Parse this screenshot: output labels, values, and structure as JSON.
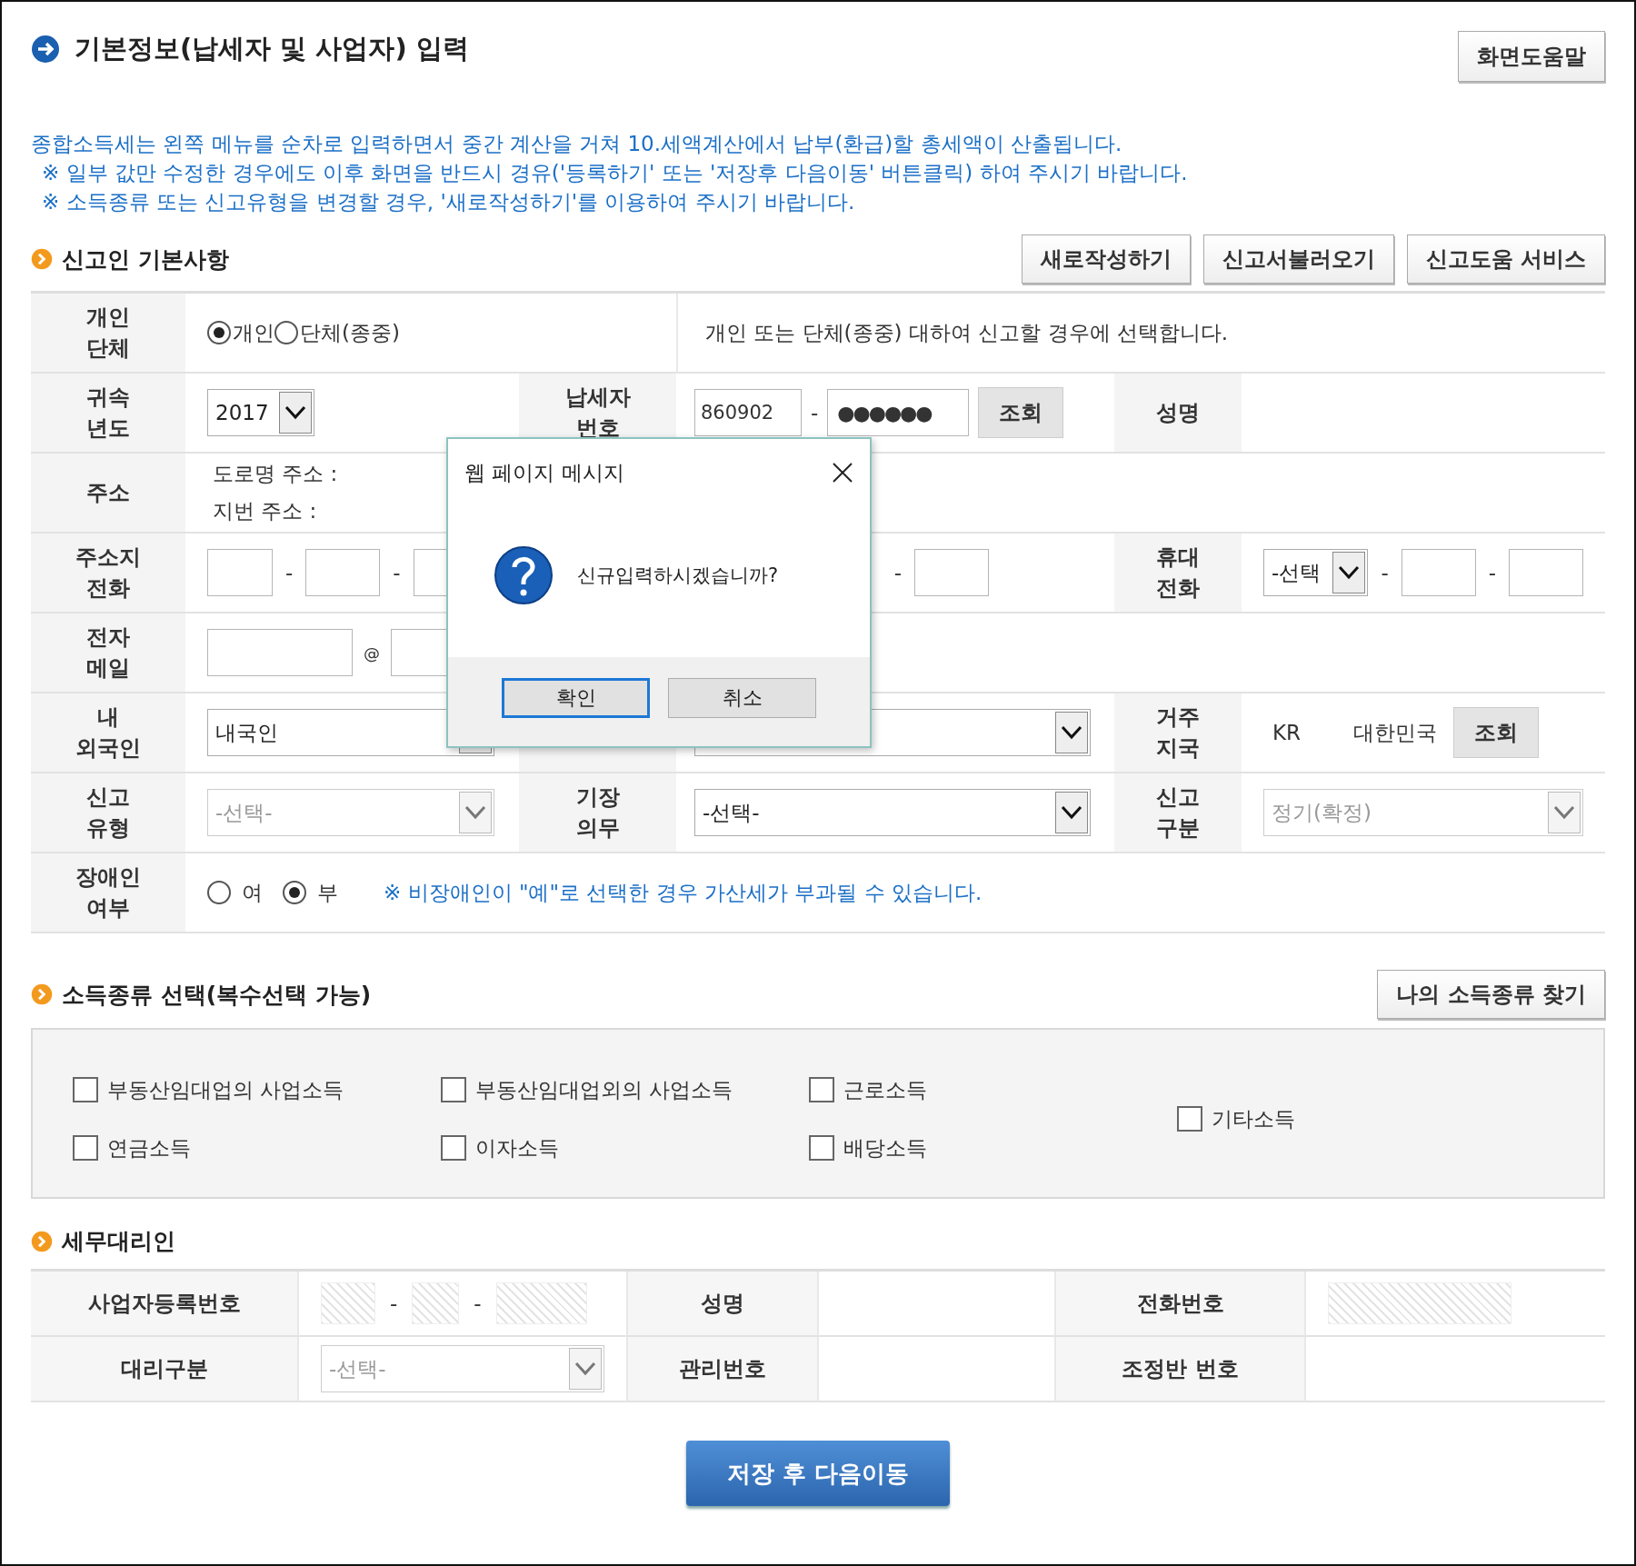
{
  "header": {
    "title": "기본정보(납세자 및 사업자) 입력",
    "help_button": "화면도움말"
  },
  "notices": [
    "종합소득세는 왼쪽 메뉴를 순차로 입력하면서 중간 계산을 거쳐 10.세액계산에서 납부(환급)할 총세액이 산출됩니다.",
    "※ 일부 값만 수정한 경우에도 이후 화면을 반드시 경유('등록하기' 또는 '저장후 다음이동' 버튼클릭) 하여 주시기 바랍니다.",
    "※ 소득종류 또는 신고유형을 변경할 경우, '새로작성하기'를 이용하여 주시기 바랍니다."
  ],
  "filer_section": {
    "title": "신고인 기본사항",
    "buttons": [
      "새로작성하기",
      "신고서불러오기",
      "신고도움 서비스"
    ]
  },
  "entity_type": {
    "label": "개인\n단체",
    "options": [
      {
        "label": "개인",
        "selected": true
      },
      {
        "label": "단체(종중)",
        "selected": false
      }
    ],
    "description": "개인 또는 단체(종중) 대하여 신고할 경우에 선택합니다."
  },
  "tax_year": {
    "label": "귀속\n년도",
    "value": "2017"
  },
  "taxpayer_id": {
    "label": "납세자\n번호",
    "front": "860902",
    "dash": "-",
    "back": "●●●●●●",
    "lookup_button": "조회"
  },
  "name": {
    "label": "성명"
  },
  "address": {
    "label": "주소",
    "road": "도로명 주소 :",
    "lot": "지번 주소 :"
  },
  "home_phone": {
    "label": "주소지\n전화",
    "dashes": [
      "-",
      "-",
      "-"
    ]
  },
  "mobile": {
    "label": "휴대\n전화",
    "carrier": "-선택",
    "dashes": [
      "-",
      "-"
    ]
  },
  "email": {
    "label": "전자\n메일",
    "at": "@"
  },
  "nationality": {
    "label": "내\n외국인",
    "value": "내국인"
  },
  "residence": {
    "label": "거주\n지국",
    "code": "KR",
    "country": "대한민국",
    "lookup_button": "조회"
  },
  "filing_type": {
    "label": "신고\n유형",
    "value": "-선택-",
    "disabled": true
  },
  "bookkeeping": {
    "label": "기장\n의무",
    "value": "-선택-",
    "disabled": false
  },
  "filing_category": {
    "label": "신고\n구분",
    "value": "정기(확정)",
    "disabled": true
  },
  "disability": {
    "label": "장애인\n여부",
    "options": [
      {
        "label": "여",
        "selected": false
      },
      {
        "label": "부",
        "selected": true
      }
    ],
    "note": "※ 비장애인이 \"예\"로 선택한 경우 가산세가 부과될 수 있습니다."
  },
  "income_section": {
    "title": "소득종류 선택(복수선택 가능)",
    "button": "나의 소득종류 찾기",
    "options": [
      {
        "label": "부동산임대업의 사업소득",
        "checked": false
      },
      {
        "label": "부동산임대업외의 사업소득",
        "checked": false
      },
      {
        "label": "근로소득",
        "checked": false
      },
      {
        "label": "기타소득",
        "checked": false
      },
      {
        "label": "연금소득",
        "checked": false
      },
      {
        "label": "이자소득",
        "checked": false
      },
      {
        "label": "배당소득",
        "checked": false
      }
    ]
  },
  "agent_section": {
    "title": "세무대리인",
    "biz_no": {
      "label": "사업자등록번호",
      "dashes": [
        "-",
        "-"
      ],
      "disabled": true
    },
    "name": {
      "label": "성명"
    },
    "phone": {
      "label": "전화번호",
      "disabled": true
    },
    "agent_type": {
      "label": "대리구분",
      "value": "-선택-",
      "disabled": true
    },
    "mgmt_no": {
      "label": "관리번호"
    },
    "team_no": {
      "label": "조정반 번호"
    }
  },
  "save_button": "저장 후 다음이동",
  "dialog": {
    "title": "웹 페이지 메시지",
    "message": "신규입력하시겠습니까?",
    "buttons": [
      {
        "label": "확인",
        "focused": true
      },
      {
        "label": "취소",
        "focused": false
      }
    ]
  }
}
